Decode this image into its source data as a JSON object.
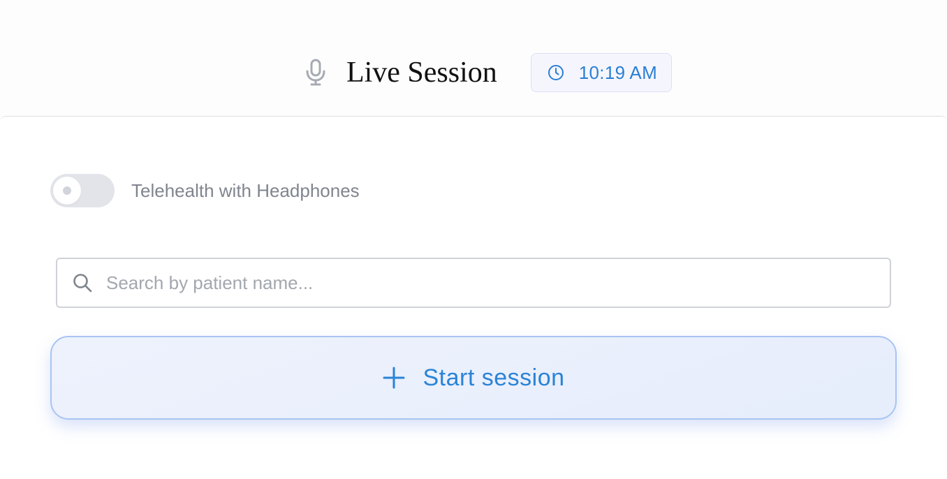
{
  "header": {
    "title": "Live Session",
    "time": "10:19 AM",
    "icons": {
      "title_icon": "microphone-icon",
      "time_icon": "clock-icon"
    }
  },
  "settings": {
    "telehealth_toggle": {
      "label": "Telehealth with Headphones",
      "enabled": false
    }
  },
  "search": {
    "placeholder": "Search by patient name...",
    "value": "",
    "icon": "search-icon"
  },
  "actions": {
    "start_session_label": "Start session",
    "start_session_icon": "plus-icon"
  },
  "colors": {
    "accent": "#2a83d6",
    "time_text": "#2a7fd4",
    "button_border": "#a8c4f2",
    "toggle_off": "#e2e4e9",
    "muted_text": "#80858e"
  }
}
